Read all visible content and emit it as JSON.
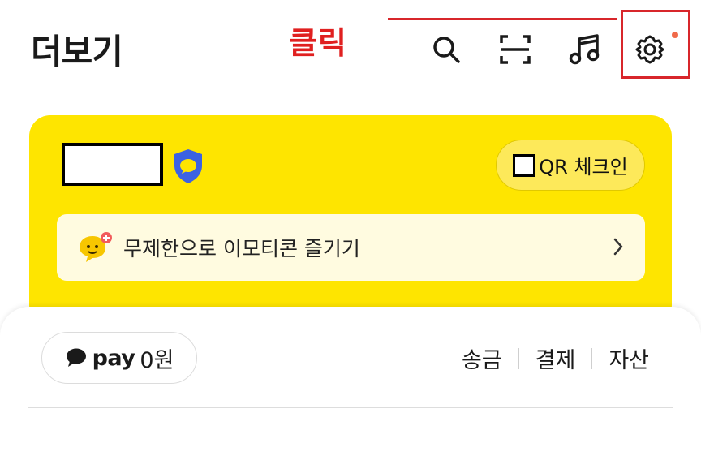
{
  "header": {
    "title": "더보기",
    "annotation": "클릭",
    "icons": [
      "search-icon",
      "scan-icon",
      "music-icon",
      "settings-icon"
    ]
  },
  "profile": {
    "qr_label": "QR 체크인",
    "banner_label": "무제한으로 이모티콘 즐기기"
  },
  "pay": {
    "brand": "pay",
    "amount": "0원",
    "actions": [
      "송금",
      "결제",
      "자산"
    ]
  },
  "colors": {
    "brand_yellow": "#fee500",
    "annotation_red": "#d8262b",
    "shield_blue": "#3b62e3",
    "notification_dot": "#f06a4a"
  }
}
